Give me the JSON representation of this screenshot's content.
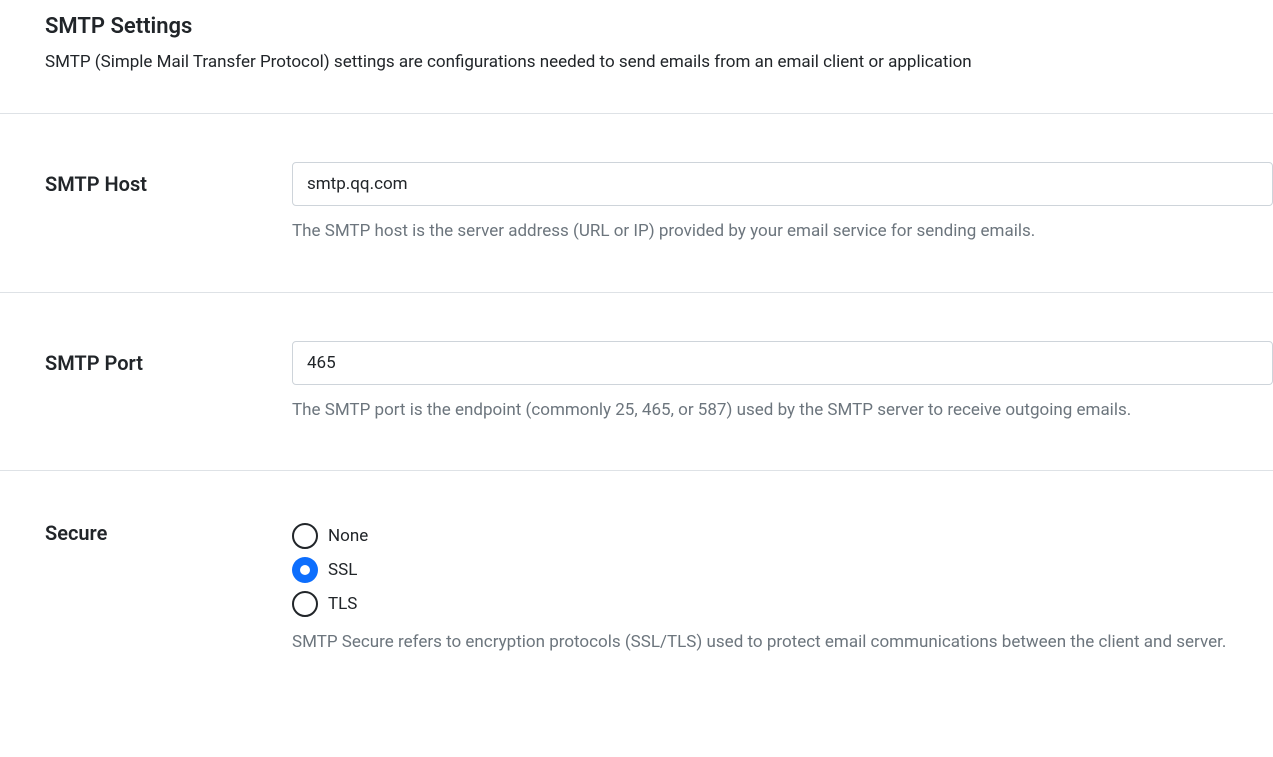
{
  "header": {
    "title": "SMTP Settings",
    "description": "SMTP (Simple Mail Transfer Protocol) settings are configurations needed to send emails from an email client or application"
  },
  "fields": {
    "host": {
      "label": "SMTP Host",
      "value": "smtp.qq.com",
      "help": "The SMTP host is the server address (URL or IP) provided by your email service for sending emails."
    },
    "port": {
      "label": "SMTP Port",
      "value": "465",
      "help": "The SMTP port is the endpoint (commonly 25, 465, or 587) used by the SMTP server to receive outgoing emails."
    },
    "secure": {
      "label": "Secure",
      "options": {
        "none": "None",
        "ssl": "SSL",
        "tls": "TLS"
      },
      "selected": "ssl",
      "help": "SMTP Secure refers to encryption protocols (SSL/TLS) used to protect email communications between the client and server."
    }
  }
}
